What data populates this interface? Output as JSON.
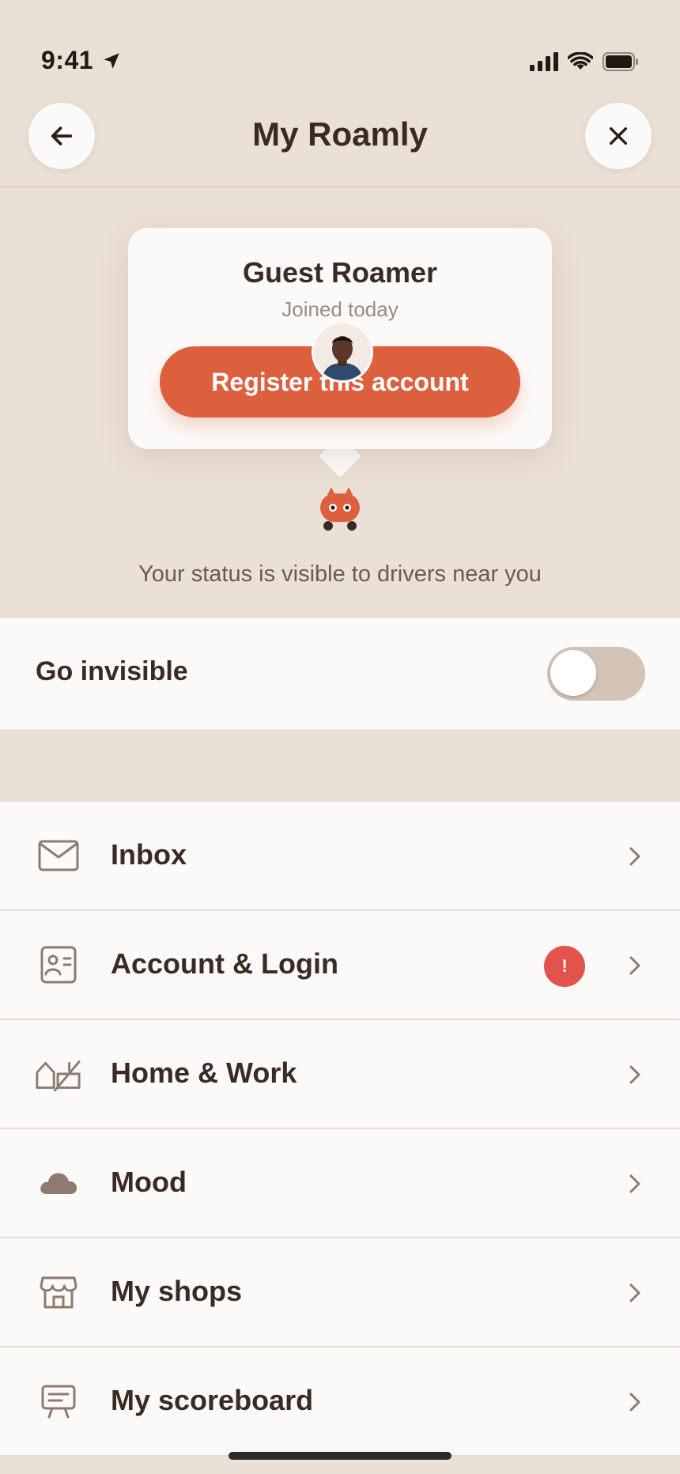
{
  "status_bar": {
    "time": "9:41"
  },
  "header": {
    "title": "My Roamly"
  },
  "profile": {
    "name": "Guest Roamer",
    "joined": "Joined today",
    "register_label": "Register this account"
  },
  "visibility": {
    "status_text": "Your status is visible to drivers near you",
    "go_invisible_label": "Go invisible",
    "toggle_on": false
  },
  "menu": {
    "items": [
      {
        "label": "Inbox",
        "icon": "envelope-icon"
      },
      {
        "label": "Account & Login",
        "icon": "id-card-icon",
        "badge": "!"
      },
      {
        "label": "Home & Work",
        "icon": "home-work-icon"
      },
      {
        "label": "Mood",
        "icon": "cloud-icon"
      },
      {
        "label": "My shops",
        "icon": "storefront-icon"
      },
      {
        "label": "My scoreboard",
        "icon": "scoreboard-icon"
      }
    ]
  },
  "colors": {
    "background": "#ebe0d6",
    "surface": "#fcfaf8",
    "accent": "#dc603d",
    "alert": "#e3534b",
    "text": "#3a2a24",
    "icon": "#8e7a70"
  }
}
